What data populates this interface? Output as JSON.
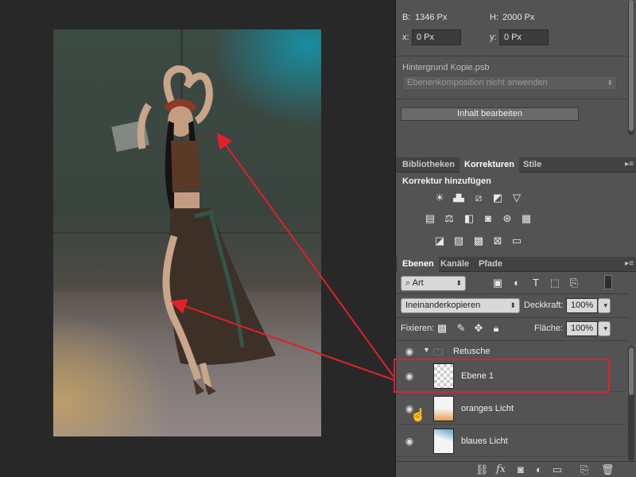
{
  "properties": {
    "width_label": "B:",
    "width_value": "1346 Px",
    "height_label": "H:",
    "height_value": "2000 Px",
    "x_label": "x:",
    "x_value": "0 Px",
    "y_label": "y:",
    "y_value": "0 Px",
    "file_name": "Hintergrund Kopie.psb",
    "comp_dropdown": "Ebenenkomposition nicht anwenden",
    "edit_button": "Inhalt bearbeiten"
  },
  "adjust_panel": {
    "tabs": [
      "Bibliotheken",
      "Korrekturen",
      "Stile"
    ],
    "active_tab": "Korrekturen",
    "heading": "Korrektur hinzufügen",
    "menu_icon": "panel-menu-icon"
  },
  "layers_panel": {
    "tabs": [
      "Ebenen",
      "Kanäle",
      "Pfade"
    ],
    "active_tab": "Ebenen",
    "filter_kind": "Art",
    "blend_mode": "Ineinanderkopieren",
    "opacity_label": "Deckkraft:",
    "opacity_value": "100%",
    "lock_label": "Fixieren:",
    "fill_label": "Fläche:",
    "fill_value": "100%",
    "group_name": "Retusche",
    "layers": [
      {
        "name": "Ebene 1",
        "selected_highlight": true
      },
      {
        "name": "oranges Licht",
        "selected_highlight": false
      },
      {
        "name": "blaues Licht",
        "selected_highlight": false
      }
    ]
  },
  "colors": {
    "panel_bg": "#535353",
    "canvas_bg": "#282828",
    "highlight_red": "#e0202a"
  }
}
